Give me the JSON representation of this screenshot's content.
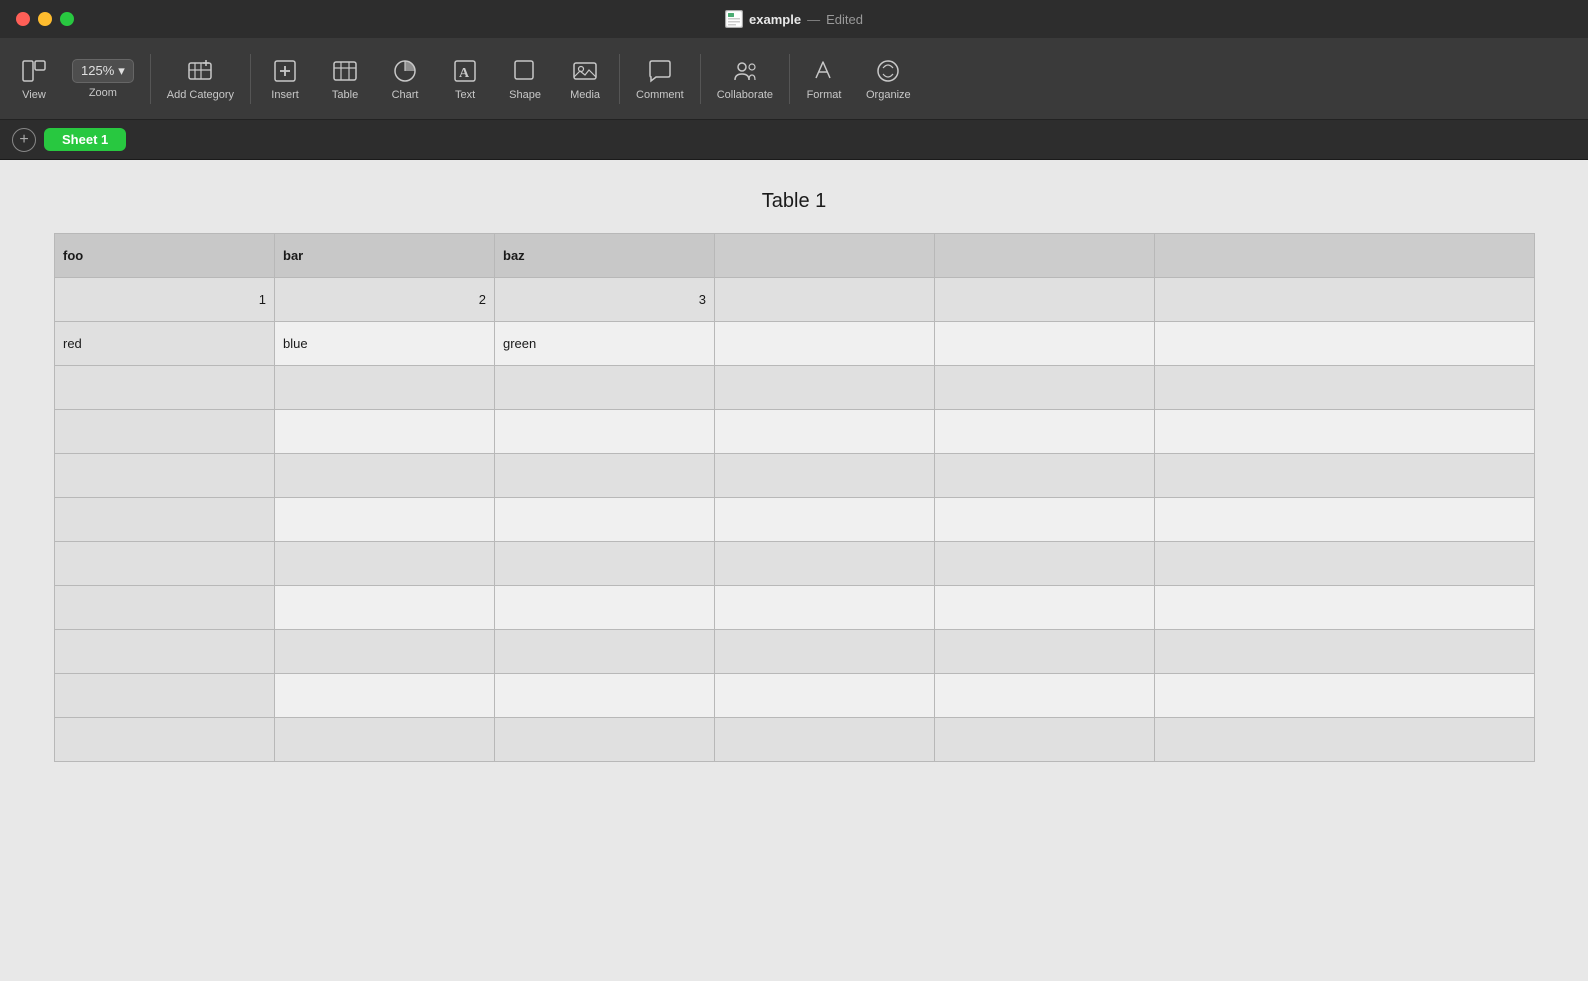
{
  "titlebar": {
    "doc_name": "example",
    "separator": "—",
    "status": "Edited"
  },
  "toolbar": {
    "view_label": "View",
    "zoom_value": "125%",
    "zoom_label": "Zoom",
    "add_category_label": "Add Category",
    "insert_label": "Insert",
    "table_label": "Table",
    "chart_label": "Chart",
    "text_label": "Text",
    "shape_label": "Shape",
    "media_label": "Media",
    "comment_label": "Comment",
    "collaborate_label": "Collaborate",
    "format_label": "Format",
    "organize_label": "Organize"
  },
  "sheet_bar": {
    "add_label": "+",
    "sheet1_label": "Sheet 1"
  },
  "spreadsheet": {
    "title": "Table 1",
    "columns": [
      "foo",
      "bar",
      "baz",
      "",
      "",
      ""
    ],
    "rows": [
      [
        "1",
        "2",
        "3",
        "",
        "",
        ""
      ],
      [
        "red",
        "blue",
        "green",
        "",
        "",
        ""
      ],
      [
        "",
        "",
        "",
        "",
        "",
        ""
      ],
      [
        "",
        "",
        "",
        "",
        "",
        ""
      ],
      [
        "",
        "",
        "",
        "",
        "",
        ""
      ],
      [
        "",
        "",
        "",
        "",
        "",
        ""
      ],
      [
        "",
        "",
        "",
        "",
        "",
        ""
      ],
      [
        "",
        "",
        "",
        "",
        "",
        ""
      ],
      [
        "",
        "",
        "",
        "",
        "",
        ""
      ],
      [
        "",
        "",
        "",
        "",
        "",
        ""
      ],
      [
        "",
        "",
        "",
        "",
        "",
        ""
      ]
    ],
    "row_types": [
      "num",
      "text",
      "empty",
      "empty",
      "empty",
      "empty",
      "empty",
      "empty",
      "empty",
      "empty",
      "empty"
    ]
  }
}
